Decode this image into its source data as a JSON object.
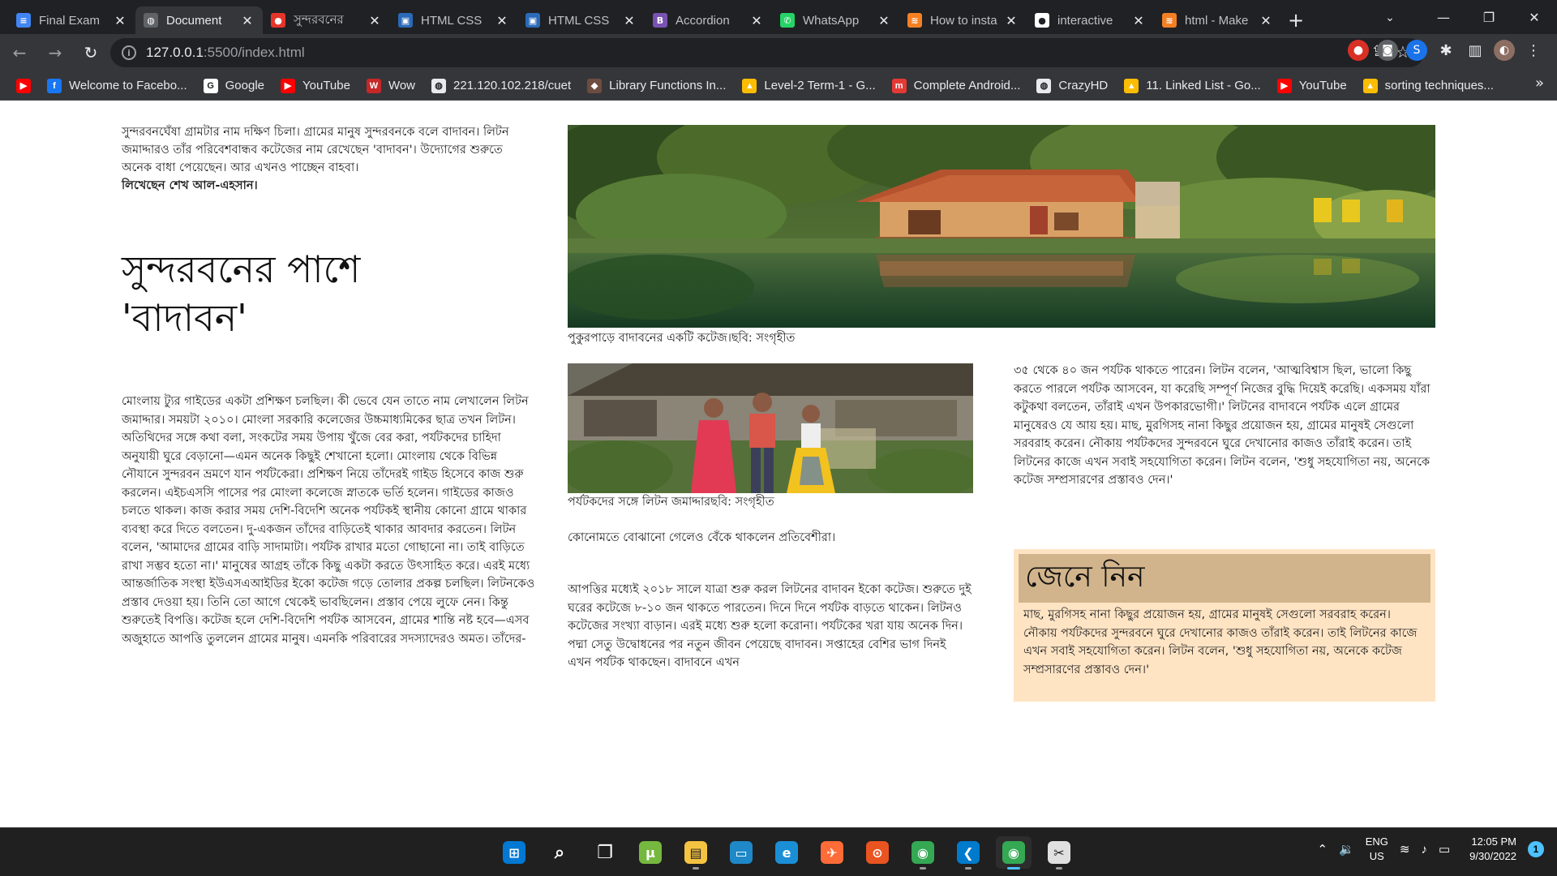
{
  "browser": {
    "tabs": [
      {
        "label": "Final Exam",
        "icon": "google-docs-icon",
        "color": "#4285f4",
        "glyph": "≡"
      },
      {
        "label": "Document",
        "icon": "globe-icon",
        "color": "#5f6368",
        "glyph": "◍"
      },
      {
        "label": "সুন্দরবনের",
        "icon": "prothomalo-icon",
        "color": "#e5352b",
        "glyph": "●"
      },
      {
        "label": "HTML CSS",
        "icon": "youtube-thumb-icon",
        "color": "#2a6ab8",
        "glyph": "▣"
      },
      {
        "label": "HTML CSS",
        "icon": "youtube-thumb-icon",
        "color": "#2a6ab8",
        "glyph": "▣"
      },
      {
        "label": "Accordion",
        "icon": "bootstrap-icon",
        "color": "#7952b3",
        "glyph": "B"
      },
      {
        "label": "WhatsApp",
        "icon": "whatsapp-icon",
        "color": "#25d366",
        "glyph": "✆"
      },
      {
        "label": "How to insta",
        "icon": "stackoverflow-icon",
        "color": "#f48024",
        "glyph": "≋"
      },
      {
        "label": "interactive",
        "icon": "github-icon",
        "color": "#ffffff",
        "glyph": "●"
      },
      {
        "label": "html - Make",
        "icon": "stackoverflow-icon",
        "color": "#f48024",
        "glyph": "≋"
      }
    ],
    "active_tab": 1,
    "url_host": "127.0.0.1",
    "url_path": ":5500/index.html",
    "bookmarks": [
      {
        "label": "",
        "icon": "youtube-icon",
        "color": "#ff0000",
        "glyph": "▶"
      },
      {
        "label": "Welcome to Facebo...",
        "icon": "facebook-icon",
        "color": "#1877f2",
        "glyph": "f"
      },
      {
        "label": "Google",
        "icon": "google-icon",
        "color": "#ffffff",
        "glyph": "G"
      },
      {
        "label": "YouTube",
        "icon": "youtube-icon",
        "color": "#ff0000",
        "glyph": "▶"
      },
      {
        "label": "Wow",
        "icon": "wow-icon",
        "color": "#c62828",
        "glyph": "W"
      },
      {
        "label": "221.120.102.218/cuet",
        "icon": "globe-icon",
        "color": "#e8eaed",
        "glyph": "◍"
      },
      {
        "label": "Library Functions In...",
        "icon": "cube-icon",
        "color": "#6d4c41",
        "glyph": "◆"
      },
      {
        "label": "Level-2 Term-1 - G...",
        "icon": "google-drive-icon",
        "color": "#fbbc04",
        "glyph": "▲"
      },
      {
        "label": "Complete Android...",
        "icon": "m-icon",
        "color": "#e53935",
        "glyph": "m"
      },
      {
        "label": "CrazyHD",
        "icon": "globe-icon",
        "color": "#e8eaed",
        "glyph": "◍"
      },
      {
        "label": "11. Linked List - Go...",
        "icon": "google-drive-icon",
        "color": "#fbbc04",
        "glyph": "▲"
      },
      {
        "label": "YouTube",
        "icon": "youtube-icon",
        "color": "#ff0000",
        "glyph": "▶"
      },
      {
        "label": "sorting techniques...",
        "icon": "google-drive-icon",
        "color": "#fbbc04",
        "glyph": "▲"
      }
    ]
  },
  "article": {
    "intro": "সুন্দরবনঘেঁষা গ্রামটার নাম দক্ষিণ চিলা। গ্রামের মানুষ সুন্দরবনকে বলে বাদাবন। লিটন জমাদ্দারও তাঁর পরিবেশবান্ধব কটেজের নাম রেখেছেন 'বাদাবন'। উদ্যোগের শুরুতে অনেক বাধা পেয়েছেন। আর এখনও পাচ্ছেন বাহবা।",
    "byline": "লিখেছেন শেখ আল-এহসান।",
    "headline_line1": "সুন্দরবনের পাশে",
    "headline_line2": "'বাদাবন'",
    "body_left": "মোংলায় ট্যুর গাইডের একটা প্রশিক্ষণ চলছিল। কী ভেবে যেন তাতে নাম লেখালেন লিটন জমাদ্দার। সময়টা ২০১০। মোংলা সরকারি কলেজের উচ্চমাধ্যমিকের ছাত্র তখন লিটন। অতিথিদের সঙ্গে কথা বলা, সংকটের সময় উপায় খুঁজে বের করা, পর্যটকদের চাহিদা অনুযায়ী ঘুরে বেড়ানো—এমন অনেক কিছুই শেখানো হলো। মোংলায় থেকে বিভিন্ন নৌযানে সুন্দরবন ভ্রমণে যান পর্যটকেরা। প্রশিক্ষণ নিয়ে তাঁদেরই গাইড হিসেবে কাজ শুরু করলেন। এইচএসসি পাসের পর মোংলা কলেজে স্নাতকে ভর্তি হলেন। গাইডের কাজও চলতে থাকল। কাজ করার সময় দেশি-বিদেশি অনেক পর্যটকই স্থানীয় কোনো গ্রামে থাকার ব্যবস্থা করে দিতে বলতেন। দু-একজন তাঁদের বাড়িতেই থাকার আবদার করতেন। লিটন বলেন, 'আমাদের গ্রামের বাড়ি সাদামাটা। পর্যটক রাখার মতো গোছানো না। তাই বাড়িতে রাখা সম্ভব হতো না।' মানুষের আগ্রহ তাঁকে কিছু একটা করতে উৎসাহিত করে। এরই মধ্যে আন্তর্জাতিক সংস্থা ইউএসএআইডির ইকো কটেজ গড়ে তোলার প্রকল্প চলছিল। লিটনকেও প্রস্তাব দেওয়া হয়। তিনি তো আগে থেকেই ভাবছিলেন। প্রস্তাব পেয়ে লুফে নেন। কিন্তু শুরুতেই বিপত্তি। কটেজ হলে দেশি-বিদেশি পর্যটক আসবেন, গ্রামের শান্তি নষ্ট হবে—এসব অজুহাতে আপত্তি তুললেন গ্রামের মানুষ। এমনকি পরিবারের সদস্যাদেরও অমত। তাঁদের-",
    "hero_caption": "পুকুরপাড়ে বাদাবনের একটি কটেজ।ছবি: সংগৃহীত",
    "photo2_caption": "পর্যটকদের সঙ্গে লিটন জমাদ্দারছবি: সংগৃহীত",
    "mid_line": "কোনোমতে বোঝানো গেলেও বেঁকে থাকলেন প্রতিবেশীরা।",
    "body_mid": "আপত্তির মধ্যেই ২০১৮ সালে যাত্রা শুরু করল লিটনের বাদাবন ইকো কটেজ। শুরুতে দুই ঘরের কটেজে ৮-১০ জন থাকতে পারতেন। দিনে দিনে পর্যটক বাড়তে থাকেন। লিটনও কটেজের সংখ্যা বাড়ান। এরই মধ্যে শুরু হলো করোনা। পর্যটকের খরা যায় অনেক দিন। পদ্মা সেতু উদ্বোধনের পর নতুন জীবন পেয়েছে বাদাবন। সপ্তাহের বেশির ভাগ দিনই এখন পর্যটক থাকছেন। বাদাবনে এখন",
    "body_right": "৩৫ থেকে ৪০ জন পর্যটক থাকতে পারেন। লিটন বলেন, 'আত্মবিশ্বাস ছিল, ভালো কিছু করতে পারলে পর্যটক আসবেন, যা করেছি সম্পূর্ণ নিজের বুদ্ধি দিয়েই করেছি। একসময় যাঁরা কটুকথা বলতেন, তাঁরাই এখন উপকারভোগী।' লিটনের বাদাবনে পর্যটক এলে গ্রামের মানুষেরও যে আয় হয়। মাছ, মুরগিসহ নানা কিছুর প্রয়োজন হয়, গ্রামের মানুষই সেগুলো সরবরাহ করেন। নৌকায় পর্যটকদের সুন্দরবনে ঘুরে দেখানোর কাজও তাঁরাই করেন। তাই লিটনের কাজে এখন সবাই সহযোগিতা করেন। লিটন বলেন, 'শুধু সহযোগিতা নয়, অনেকে কটেজ সম্প্রসারণের প্রস্তাবও দেন।'",
    "infobox_title": "জেনে নিন",
    "infobox_text": "মাছ, মুরগিসহ নানা কিছুর প্রয়োজন হয়, গ্রামের মানুষই সেগুলো সরবরাহ করেন। নৌকায় পর্যটকদের সুন্দরবনে ঘুরে দেখানোর কাজও তাঁরাই করেন। তাই লিটনের কাজে এখন সবাই সহযোগিতা করেন। লিটন বলেন, 'শুধু সহযোগিতা নয়, অনেকে কটেজ সম্প্রসারণের প্রস্তাবও দেন।'",
    "infobox_bg": "#ffe4c4",
    "infobox_head_bg": "#d2b48c"
  },
  "taskbar": {
    "apps": [
      {
        "name": "start-icon",
        "color": "#0078d4",
        "glyph": "⊞"
      },
      {
        "name": "search-icon",
        "color": "#202020",
        "glyph": "⌕"
      },
      {
        "name": "task-view-icon",
        "color": "#202020",
        "glyph": "❐"
      },
      {
        "name": "utorrent-icon",
        "color": "#76b83f",
        "glyph": "µ"
      },
      {
        "name": "file-explorer-icon",
        "color": "#f5c342",
        "glyph": "▤"
      },
      {
        "name": "computer-icon",
        "color": "#1e88c8",
        "glyph": "▭"
      },
      {
        "name": "edge-icon",
        "color": "#1a8fd6",
        "glyph": "e"
      },
      {
        "name": "postman-icon",
        "color": "#ff6c37",
        "glyph": "✈"
      },
      {
        "name": "ubuntu-2204-icon",
        "color": "#e95420",
        "glyph": "⊙"
      },
      {
        "name": "chrome-icon",
        "color": "#34a853",
        "glyph": "◉"
      },
      {
        "name": "vscode-icon",
        "color": "#007acc",
        "glyph": "❮"
      },
      {
        "name": "chrome-profile-icon",
        "color": "#34a853",
        "glyph": "◉"
      },
      {
        "name": "snipping-tool-icon",
        "color": "#e0e0e0",
        "glyph": "✂"
      }
    ],
    "active_app": 11,
    "lang_line1": "ENG",
    "lang_line2": "US",
    "time": "12:05 PM",
    "date": "9/30/2022",
    "notifications": "1"
  }
}
